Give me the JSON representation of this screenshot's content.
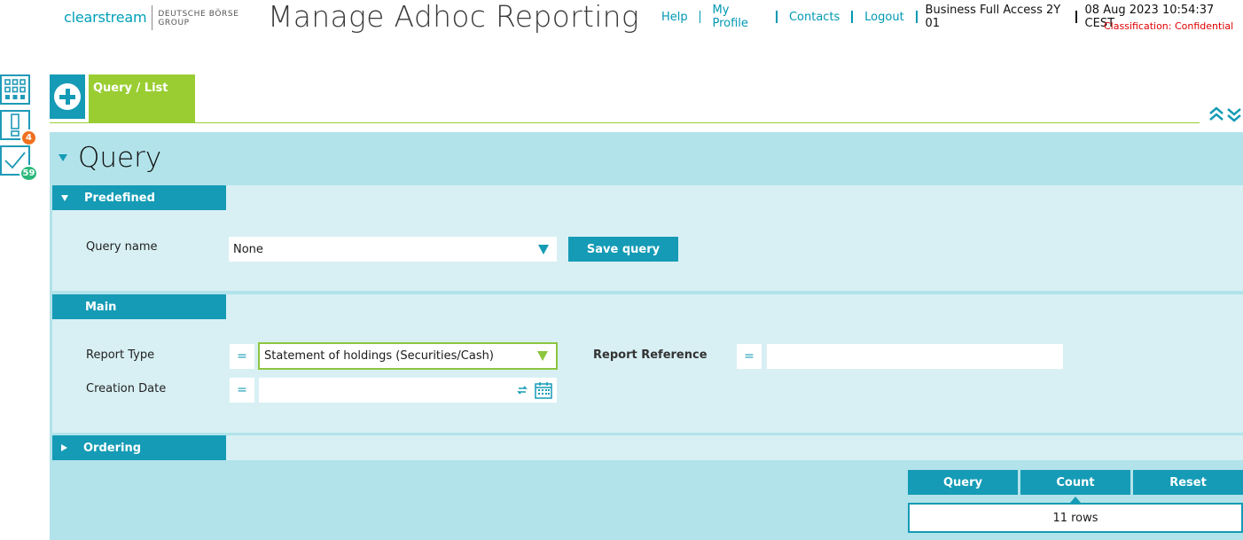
{
  "header": {
    "logo_brand": "clearstream",
    "logo_group_line1": "DEUTSCHE BÖRSE",
    "logo_group_line2": "GROUP",
    "title": "Manage Adhoc Reporting",
    "nav": [
      "Help",
      "My Profile",
      "Contacts",
      "Logout"
    ],
    "account": "Business Full Access 2Y 01",
    "datetime": "08 Aug 2023 10:54:37 CEST",
    "classification": "Classification: Confidential"
  },
  "sidebar": {
    "items": [
      {
        "icon": "grid-icon"
      },
      {
        "icon": "alert-icon",
        "badge": "4",
        "badge_color": "#f07020"
      },
      {
        "icon": "check-icon",
        "badge": "59",
        "badge_color": "#2ab87a"
      }
    ]
  },
  "tabs": {
    "add_icon": "plus-icon",
    "active_label": "Query / List"
  },
  "query": {
    "heading": "Query",
    "predefined": {
      "title": "Predefined",
      "query_name_label": "Query name",
      "query_name_value": "None",
      "save_label": "Save query"
    },
    "main": {
      "title": "Main",
      "report_type_label": "Report Type",
      "report_type_op": "=",
      "report_type_value": "Statement of holdings (Securities/Cash)",
      "report_ref_label": "Report Reference",
      "report_ref_op": "=",
      "report_ref_value": "",
      "creation_date_label": "Creation Date",
      "creation_date_op": "=",
      "creation_date_value": ""
    },
    "ordering": {
      "title": "Ordering"
    },
    "actions": {
      "query": "Query",
      "count": "Count",
      "reset": "Reset"
    },
    "result": "11 rows"
  },
  "colors": {
    "accent": "#159bb5",
    "tab_active": "#9acd32",
    "panel": "#b2e3ea",
    "section": "#d8f0f4"
  }
}
